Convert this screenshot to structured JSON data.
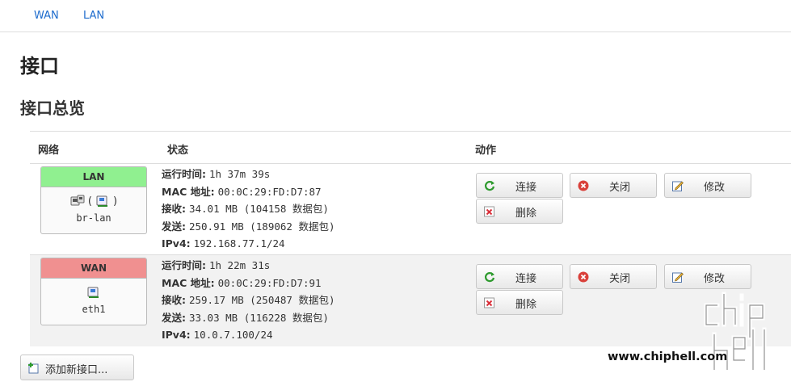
{
  "subtabs": {
    "wan": "WAN",
    "lan": "LAN"
  },
  "page_title": "接口",
  "section_title": "接口总览",
  "table": {
    "headers": {
      "network": "网络",
      "status": "状态",
      "actions": "动作"
    },
    "rows": [
      {
        "name": "LAN",
        "header_color": "#90f090",
        "device": "br-lan",
        "icons_text": "(",
        "icons_text_close": ")",
        "uptime_label": "运行时间:",
        "uptime": "1h 37m 39s",
        "mac_label": "MAC 地址:",
        "mac": "00:0C:29:FD:D7:87",
        "rx_label": "接收:",
        "rx": "34.01 MB (104158 数据包)",
        "tx_label": "发送:",
        "tx": "250.91 MB (189062 数据包)",
        "ipv4_label": "IPv4:",
        "ipv4": "192.168.77.1/24"
      },
      {
        "name": "WAN",
        "header_color": "#f09090",
        "device": "eth1",
        "uptime_label": "运行时间:",
        "uptime": "1h 22m 31s",
        "mac_label": "MAC 地址:",
        "mac": "00:0C:29:FD:D7:91",
        "rx_label": "接收:",
        "rx": "259.17 MB (250487 数据包)",
        "tx_label": "发送:",
        "tx": "33.03 MB (116228 数据包)",
        "ipv4_label": "IPv4:",
        "ipv4": "10.0.7.100/24"
      }
    ]
  },
  "buttons": {
    "connect": "连接",
    "close": "关闭",
    "edit": "修改",
    "delete": "删除",
    "add_interface": "添加新接口..."
  },
  "watermark": {
    "text": "www.chiphell.com"
  },
  "icons": {
    "connect": "refresh-icon",
    "close": "stop-icon",
    "edit": "edit-icon",
    "delete": "delete-icon",
    "add": "add-icon",
    "ethernet": "ethernet-port-icon",
    "bridge": "bridge-icon"
  }
}
